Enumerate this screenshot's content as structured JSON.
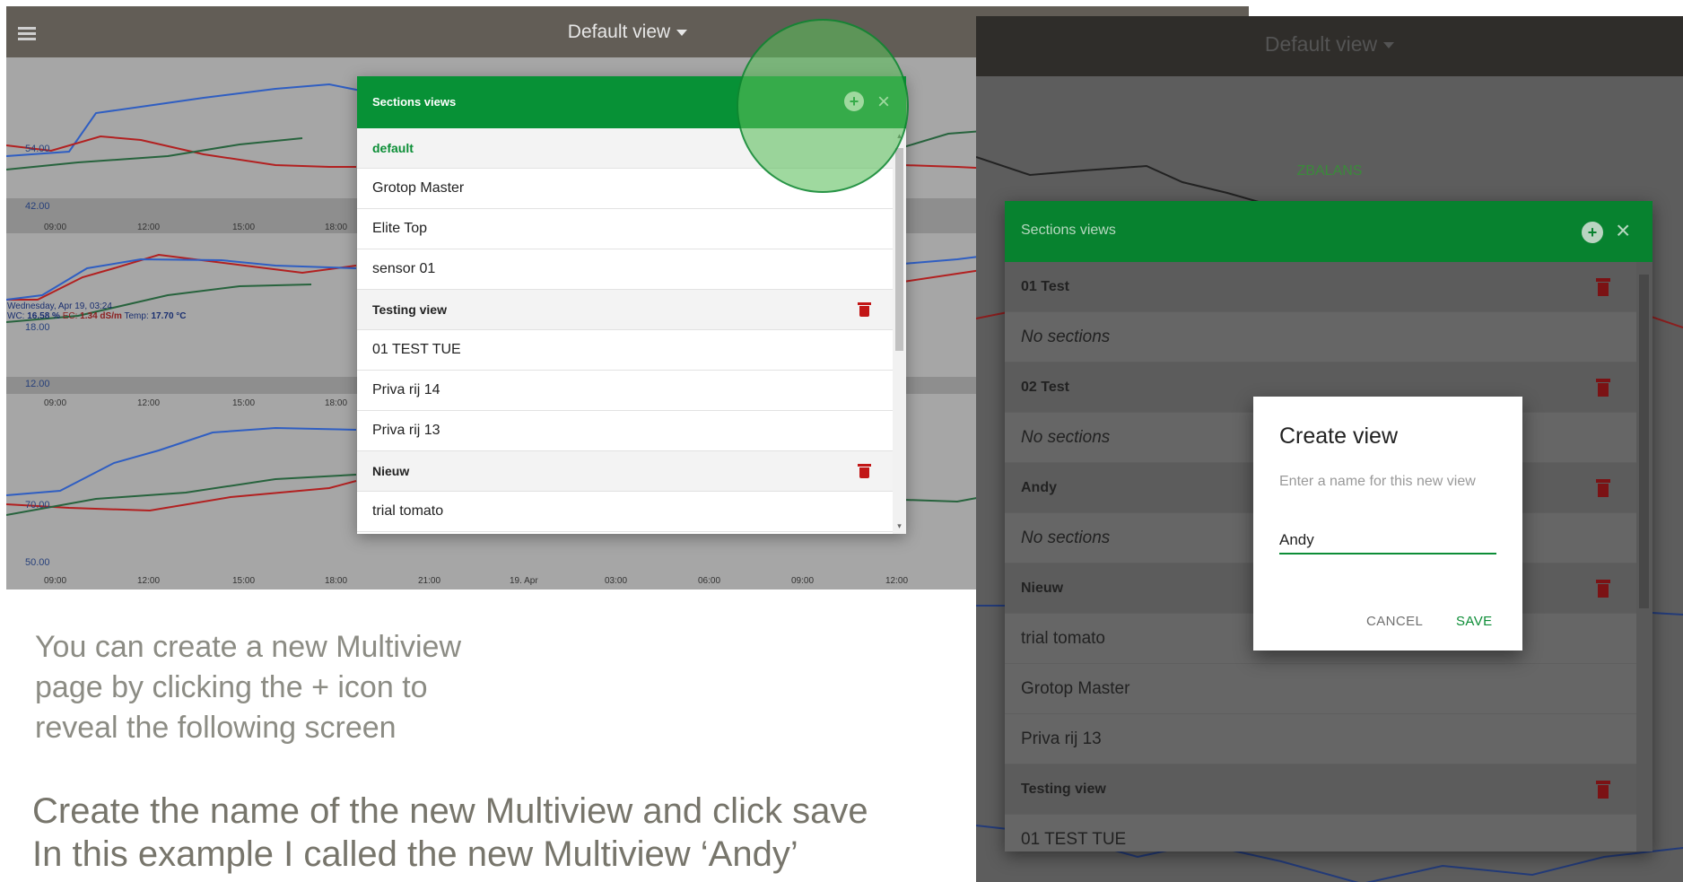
{
  "left_screen": {
    "title": "Default view",
    "chart_status": {
      "date": "Wednesday, Apr 19, 03:24",
      "wc_label": "WC:",
      "wc_value": "16.58 %",
      "ec_label": "EC:",
      "ec_value": "1.34 dS/m",
      "temp_label": "Temp:",
      "temp_value": "17.70 °C"
    },
    "chart_labels": [
      "54.00",
      "42.00",
      "18.00",
      "12.00",
      "70.00",
      "50.00"
    ],
    "ticks": [
      [
        "09:00",
        "12:00",
        "15:00",
        "18:00"
      ],
      [
        "09:00",
        "12:00",
        "15:00",
        "18:00"
      ],
      [
        "09:00",
        "12:00",
        "15:00",
        "18:00",
        "21:00",
        "19. Apr",
        "03:00",
        "06:00",
        "09:00",
        "12:00"
      ]
    ],
    "dialog": {
      "title": "Sections views",
      "rows": [
        {
          "label": "default",
          "kind": "header active"
        },
        {
          "label": "Grotop Master",
          "kind": "item"
        },
        {
          "label": "Elite Top",
          "kind": "item"
        },
        {
          "label": "sensor 01",
          "kind": "item"
        },
        {
          "label": "Testing view",
          "kind": "header",
          "trash": true
        },
        {
          "label": "01 TEST TUE",
          "kind": "item"
        },
        {
          "label": "Priva rij 14",
          "kind": "item"
        },
        {
          "label": "Priva rij 13",
          "kind": "item"
        },
        {
          "label": "Nieuw",
          "kind": "header",
          "trash": true
        },
        {
          "label": "trial tomato",
          "kind": "item"
        }
      ]
    }
  },
  "instructions": {
    "line1": "You can create a new Multiview",
    "line2": "page by clicking the + icon to",
    "line3": "reveal the following screen",
    "line4": "Create the name of the new Multiview and click save",
    "line5": "In this example I called the new Multiview ‘Andy’"
  },
  "right_screen": {
    "title": "Default view",
    "section_label": "ZBALANS",
    "dialog": {
      "title": "Sections views",
      "rows": [
        {
          "label": "01 Test",
          "kind": "header",
          "trash": true
        },
        {
          "label": "No sections",
          "kind": "italic"
        },
        {
          "label": "02 Test",
          "kind": "header",
          "trash": true
        },
        {
          "label": "No sections",
          "kind": "italic"
        },
        {
          "label": "Andy",
          "kind": "header",
          "trash": true
        },
        {
          "label": "No sections",
          "kind": "italic"
        },
        {
          "label": "Nieuw",
          "kind": "header",
          "trash": true
        },
        {
          "label": "trial tomato",
          "kind": "item"
        },
        {
          "label": "Grotop Master",
          "kind": "item"
        },
        {
          "label": "Priva rij 13",
          "kind": "item"
        },
        {
          "label": "Testing view",
          "kind": "header",
          "trash": true
        },
        {
          "label": "01 TEST TUE",
          "kind": "item"
        }
      ]
    },
    "create_dialog": {
      "title": "Create view",
      "hint": "Enter a name for this new view",
      "value": "Andy",
      "cancel": "CANCEL",
      "save": "SAVE"
    }
  },
  "colors": {
    "green": "#079136",
    "trash": "#c21616",
    "blue_line": "#2f5ec2",
    "red_line": "#b22020",
    "dark_green_line": "#27633d"
  }
}
